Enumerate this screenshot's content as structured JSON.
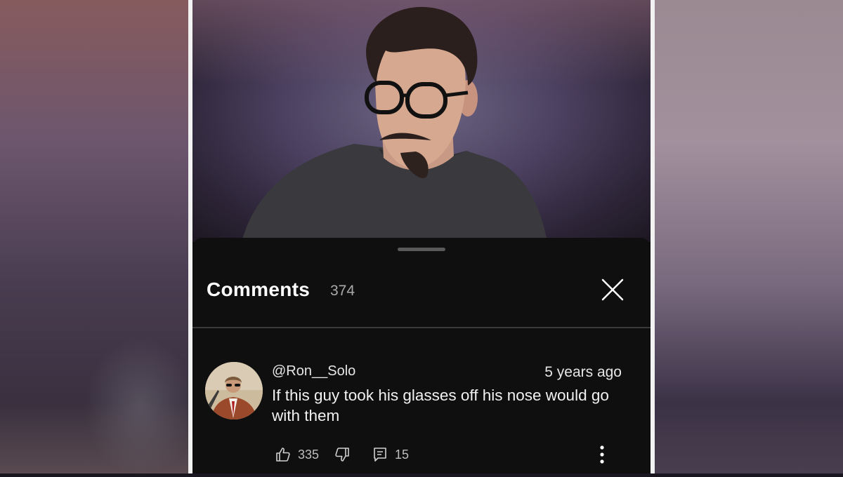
{
  "header": {
    "title": "Comments",
    "count": "374"
  },
  "comment": {
    "username": "@Ron__Solo",
    "timestamp": "5 years ago",
    "text": "If this guy took his glasses off his nose would go with them",
    "likes": "335",
    "replies": "15"
  },
  "icons": {
    "close": "close-icon",
    "like": "thumbs-up-icon",
    "dislike": "thumbs-down-icon",
    "replies": "comment-reply-icon",
    "more": "more-vertical-icon"
  },
  "colors": {
    "sheet_background": "#0f0f0f",
    "primary_text": "#ffffff",
    "secondary_text": "#aaaaaa"
  }
}
